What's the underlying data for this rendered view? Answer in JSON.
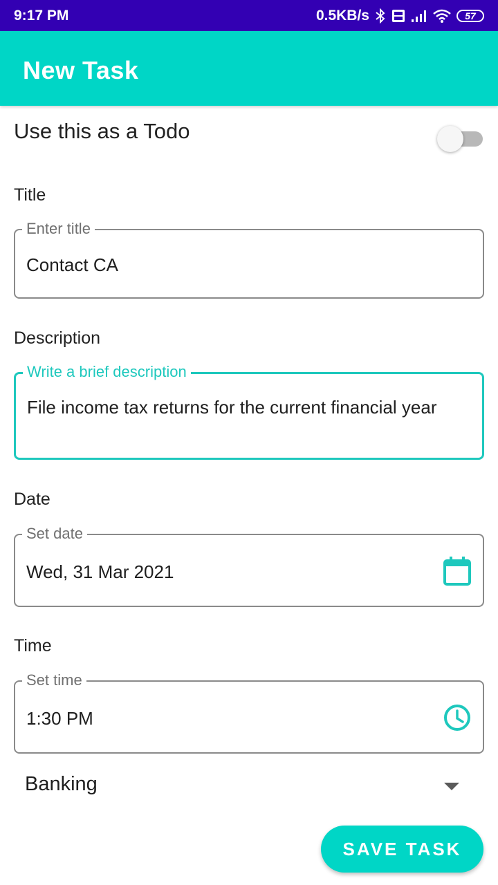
{
  "status_bar": {
    "time": "9:17 PM",
    "network_speed": "0.5KB/s",
    "battery": "57",
    "icons": [
      "bluetooth-icon",
      "volte-icon",
      "signal-icon",
      "wifi-icon",
      "battery-icon"
    ]
  },
  "app_bar": {
    "title": "New Task",
    "color": "#00d6c6"
  },
  "todo": {
    "label": "Use this as a Todo",
    "enabled": false
  },
  "title_section": {
    "label": "Title",
    "legend": "Enter title",
    "value": "Contact CA"
  },
  "description_section": {
    "label": "Description",
    "legend": "Write a brief description",
    "value": "File income tax returns for the current financial year"
  },
  "date_section": {
    "label": "Date",
    "legend": "Set date",
    "value": "Wed, 31 Mar 2021",
    "icon": "calendar-icon"
  },
  "time_section": {
    "label": "Time",
    "legend": "Set time",
    "value": "1:30 PM",
    "icon": "clock-icon"
  },
  "category": {
    "selected": "Banking"
  },
  "save_button": {
    "label": "SAVE TASK"
  },
  "colors": {
    "accent": "#1ec8bd",
    "status_bar": "#3300b3"
  }
}
